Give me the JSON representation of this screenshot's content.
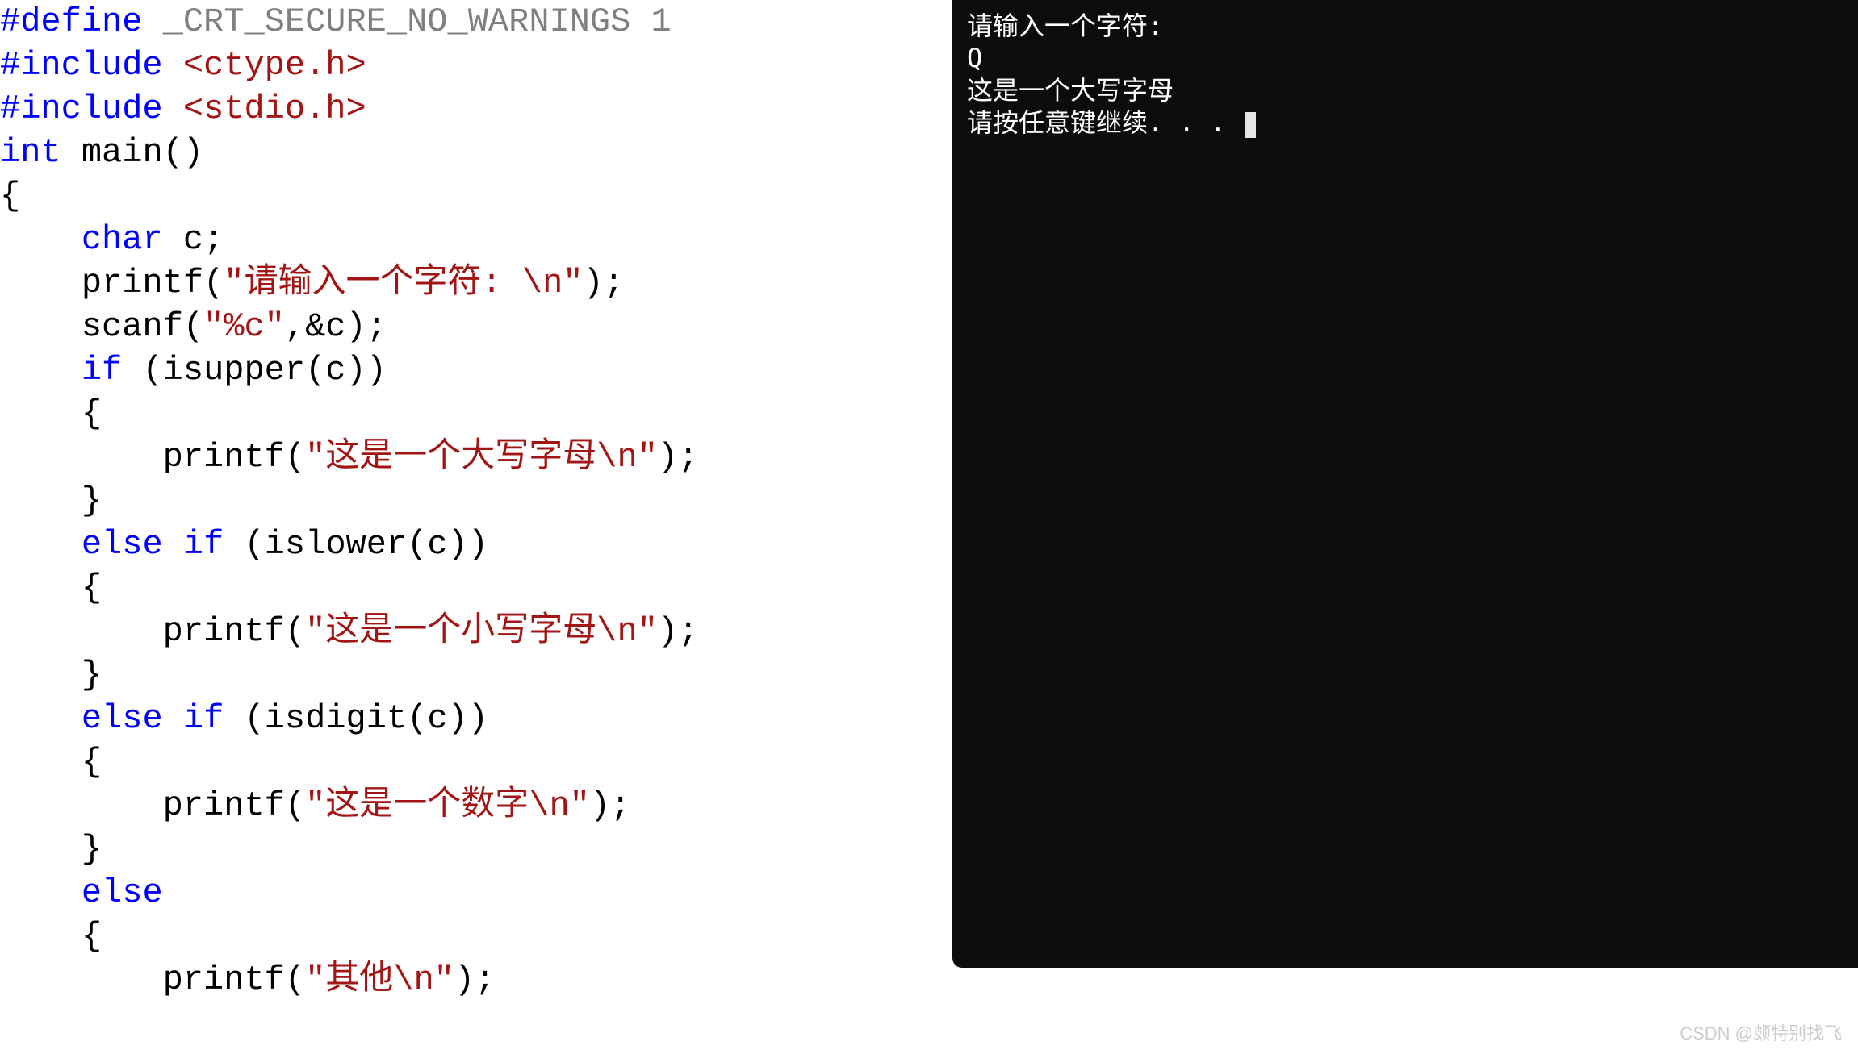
{
  "code": {
    "tokens": [
      [
        {
          "t": "#define",
          "c": "kw-preprocessor"
        },
        {
          "t": " _CRT_SECURE_NO_WARNINGS 1",
          "c": "gray"
        }
      ],
      [
        {
          "t": "",
          "c": "plain"
        }
      ],
      [
        {
          "t": "#include",
          "c": "kw-include"
        },
        {
          "t": " ",
          "c": "plain"
        },
        {
          "t": "<ctype.h>",
          "c": "include-path"
        }
      ],
      [
        {
          "t": "#include",
          "c": "kw-include"
        },
        {
          "t": " ",
          "c": "plain"
        },
        {
          "t": "<stdio.h>",
          "c": "include-path"
        }
      ],
      [
        {
          "t": "int",
          "c": "kw-type"
        },
        {
          "t": " main()",
          "c": "plain"
        }
      ],
      [
        {
          "t": "{",
          "c": "plain"
        }
      ],
      [
        {
          "t": "    ",
          "c": "plain"
        },
        {
          "t": "char",
          "c": "kw-type"
        },
        {
          "t": " c;",
          "c": "plain"
        }
      ],
      [
        {
          "t": "    printf(",
          "c": "plain"
        },
        {
          "t": "\"请输入一个字符: \\n\"",
          "c": "str-literal"
        },
        {
          "t": ");",
          "c": "plain"
        }
      ],
      [
        {
          "t": "    scanf(",
          "c": "plain"
        },
        {
          "t": "\"%c\"",
          "c": "str-literal"
        },
        {
          "t": ",&c);",
          "c": "plain"
        }
      ],
      [
        {
          "t": "    ",
          "c": "plain"
        },
        {
          "t": "if",
          "c": "kw-control"
        },
        {
          "t": " (isupper(c))",
          "c": "plain"
        }
      ],
      [
        {
          "t": "    {",
          "c": "plain"
        }
      ],
      [
        {
          "t": "        printf(",
          "c": "plain"
        },
        {
          "t": "\"这是一个大写字母\\n\"",
          "c": "str-literal"
        },
        {
          "t": ");",
          "c": "plain"
        }
      ],
      [
        {
          "t": "    }",
          "c": "plain"
        }
      ],
      [
        {
          "t": "    ",
          "c": "plain"
        },
        {
          "t": "else",
          "c": "kw-control"
        },
        {
          "t": " ",
          "c": "plain"
        },
        {
          "t": "if",
          "c": "kw-control"
        },
        {
          "t": " (islower(c))",
          "c": "plain"
        }
      ],
      [
        {
          "t": "    {",
          "c": "plain"
        }
      ],
      [
        {
          "t": "        printf(",
          "c": "plain"
        },
        {
          "t": "\"这是一个小写字母\\n\"",
          "c": "str-literal"
        },
        {
          "t": ");",
          "c": "plain"
        }
      ],
      [
        {
          "t": "    }",
          "c": "plain"
        }
      ],
      [
        {
          "t": "    ",
          "c": "plain"
        },
        {
          "t": "else",
          "c": "kw-control"
        },
        {
          "t": " ",
          "c": "plain"
        },
        {
          "t": "if",
          "c": "kw-control"
        },
        {
          "t": " (isdigit(c))",
          "c": "plain"
        }
      ],
      [
        {
          "t": "    {",
          "c": "plain"
        }
      ],
      [
        {
          "t": "        printf(",
          "c": "plain"
        },
        {
          "t": "\"这是一个数字\\n\"",
          "c": "str-literal"
        },
        {
          "t": ");",
          "c": "plain"
        }
      ],
      [
        {
          "t": "    }",
          "c": "plain"
        }
      ],
      [
        {
          "t": "    ",
          "c": "plain"
        },
        {
          "t": "else",
          "c": "kw-control"
        }
      ],
      [
        {
          "t": "    {",
          "c": "plain"
        }
      ],
      [
        {
          "t": "        printf(",
          "c": "plain"
        },
        {
          "t": "\"其他\\n\"",
          "c": "str-literal"
        },
        {
          "t": ");",
          "c": "plain"
        }
      ]
    ]
  },
  "console": {
    "lines": [
      "请输入一个字符:",
      "Q",
      "这是一个大写字母",
      "请按任意键继续. . . "
    ]
  },
  "watermark": "CSDN @颇特别找飞"
}
